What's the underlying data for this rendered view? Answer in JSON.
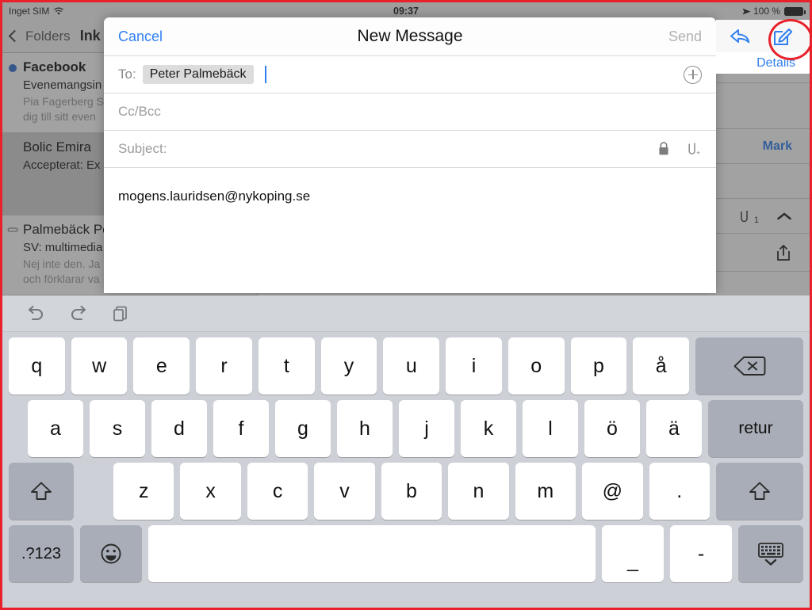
{
  "status_bar": {
    "carrier": "Inget SIM",
    "wifi_icon": "wifi-icon",
    "time": "09:37",
    "location_icon": "location-arrow-icon",
    "battery_percent": "100 %",
    "battery_icon": "battery-full-icon"
  },
  "mail_list": {
    "back_label": "Folders",
    "title": "Ink",
    "back_icon": "chevron-left-icon",
    "rows": [
      {
        "from": "Facebook",
        "subject": "Evenemangsin",
        "preview_line1": "Pia Fagerberg S",
        "preview_line2": "dig till sitt even",
        "unread": true,
        "selected": false,
        "attachment": false
      },
      {
        "from": "Bolic Emira",
        "subject": "Accepterat: Ex",
        "preview_line1": "",
        "preview_line2": "",
        "unread": false,
        "selected": true,
        "attachment": false
      },
      {
        "from": "Palmebäck Pe",
        "subject": "SV: multimedia",
        "preview_line1": "Nej inte den. Ja",
        "preview_line2": "och förklarar va",
        "unread": false,
        "selected": false,
        "attachment": true,
        "attachment_icon": "paperclip-icon"
      }
    ]
  },
  "read_pane": {
    "reply_icon": "reply-arrow-icon",
    "compose_icon": "compose-pencil-icon",
    "details_label": "Details",
    "mark_label": "Mark",
    "attachment_icon": "paperclip-icon",
    "attachment_count": "1",
    "collapse_icon": "chevron-up-icon",
    "share_icon": "share-up-arrow-icon"
  },
  "compose": {
    "cancel_label": "Cancel",
    "title": "New Message",
    "send_label": "Send",
    "to_label": "To:",
    "to_recipient": "Peter Palmebäck",
    "add_contact_icon": "plus-circle-icon",
    "ccbcc_placeholder": "Cc/Bcc",
    "subject_placeholder": "Subject:",
    "lock_icon": "lock-icon",
    "attach_icon": "paperclip-plus-icon",
    "body_text": "mogens.lauridsen@nykoping.se"
  },
  "keyboard": {
    "toolbar": {
      "undo_icon": "undo-arrow-icon",
      "redo_icon": "redo-arrow-icon",
      "copy_icon": "copy-documents-icon"
    },
    "row1": [
      "q",
      "w",
      "e",
      "r",
      "t",
      "y",
      "u",
      "i",
      "o",
      "p",
      "å"
    ],
    "row1_action": {
      "label": "backspace-icon",
      "name": "backspace-key"
    },
    "row2": [
      "a",
      "s",
      "d",
      "f",
      "g",
      "h",
      "j",
      "k",
      "l",
      "ö",
      "ä"
    ],
    "row2_action": {
      "label": "retur",
      "name": "return-key"
    },
    "row3_shift_left": "shift-up-icon",
    "row3": [
      "z",
      "x",
      "c",
      "v",
      "b",
      "n",
      "m",
      "@",
      "."
    ],
    "row3_shift_right": "shift-up-icon",
    "row4": {
      "numbers_label": ".?123",
      "emoji_icon": "emoji-smiley-icon",
      "space_label": "",
      "underscore_label": "_",
      "hyphen_label": "-",
      "dismiss_icon": "hide-keyboard-icon"
    }
  },
  "annotation": {
    "highlight_icon": "red-ellipse-highlight",
    "border_color": "#e8212a"
  }
}
